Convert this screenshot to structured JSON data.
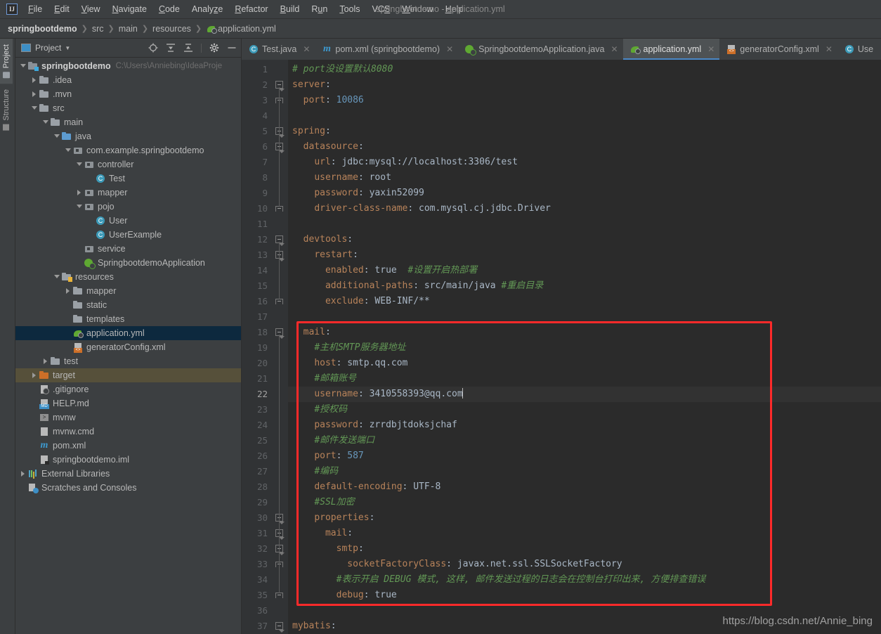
{
  "window": {
    "title": "springbootdemo - application.yml"
  },
  "menu": {
    "items": [
      {
        "label": "File",
        "mnemonic": "F"
      },
      {
        "label": "Edit",
        "mnemonic": "E"
      },
      {
        "label": "View",
        "mnemonic": "V"
      },
      {
        "label": "Navigate",
        "mnemonic": "N"
      },
      {
        "label": "Code",
        "mnemonic": "C"
      },
      {
        "label": "Analyze",
        "mnemonic": "z"
      },
      {
        "label": "Refactor",
        "mnemonic": "R"
      },
      {
        "label": "Build",
        "mnemonic": "B"
      },
      {
        "label": "Run",
        "mnemonic": "u"
      },
      {
        "label": "Tools",
        "mnemonic": "T"
      },
      {
        "label": "VCS",
        "mnemonic": "S"
      },
      {
        "label": "Window",
        "mnemonic": "W"
      },
      {
        "label": "Help",
        "mnemonic": "H"
      }
    ]
  },
  "breadcrumb": {
    "items": [
      "springbootdemo",
      "src",
      "main",
      "resources",
      "application.yml"
    ],
    "file_icon": "spring-yaml-icon"
  },
  "toolwindow_bar": {
    "tabs": [
      {
        "label": "Project",
        "icon": "project-folder-icon",
        "active": true
      },
      {
        "label": "Structure",
        "icon": "structure-icon",
        "active": false
      }
    ]
  },
  "project_panel": {
    "title": "Project",
    "dropdown_icon": "chevron-down-icon",
    "tools": [
      {
        "name": "locate-icon",
        "title": "Select Opened File"
      },
      {
        "name": "expand-all-icon",
        "title": "Expand All"
      },
      {
        "name": "collapse-all-icon",
        "title": "Collapse All"
      },
      {
        "name": "gear-icon",
        "title": "Settings"
      },
      {
        "name": "hide-icon",
        "title": "Hide"
      }
    ],
    "tree": [
      {
        "indent": 0,
        "arrow": "open",
        "icon": "module-folder-icon",
        "label": "springbootdemo",
        "bold": true,
        "path": "C:\\Users\\Anniebing\\IdeaProje",
        "state": "normal"
      },
      {
        "indent": 1,
        "arrow": "closed",
        "icon": "folder-icon",
        "label": ".idea",
        "state": "normal"
      },
      {
        "indent": 1,
        "arrow": "closed",
        "icon": "folder-icon",
        "label": ".mvn",
        "state": "normal"
      },
      {
        "indent": 1,
        "arrow": "open",
        "icon": "folder-icon",
        "label": "src",
        "state": "normal"
      },
      {
        "indent": 2,
        "arrow": "open",
        "icon": "folder-icon",
        "label": "main",
        "state": "normal"
      },
      {
        "indent": 3,
        "arrow": "open",
        "icon": "source-folder-icon",
        "label": "java",
        "state": "normal"
      },
      {
        "indent": 4,
        "arrow": "open",
        "icon": "package-icon",
        "label": "com.example.springbootdemo",
        "state": "normal"
      },
      {
        "indent": 5,
        "arrow": "open",
        "icon": "package-icon",
        "label": "controller",
        "state": "normal"
      },
      {
        "indent": 6,
        "arrow": "none",
        "icon": "java-class-icon",
        "label": "Test",
        "state": "normal"
      },
      {
        "indent": 5,
        "arrow": "closed",
        "icon": "package-icon",
        "label": "mapper",
        "state": "normal"
      },
      {
        "indent": 5,
        "arrow": "open",
        "icon": "package-icon",
        "label": "pojo",
        "state": "normal"
      },
      {
        "indent": 6,
        "arrow": "none",
        "icon": "java-class-icon",
        "label": "User",
        "state": "normal"
      },
      {
        "indent": 6,
        "arrow": "none",
        "icon": "java-class-icon",
        "label": "UserExample",
        "state": "normal"
      },
      {
        "indent": 5,
        "arrow": "none",
        "icon": "package-icon",
        "label": "service",
        "state": "normal"
      },
      {
        "indent": 5,
        "arrow": "none",
        "icon": "spring-app-icon",
        "label": "SpringbootdemoApplication",
        "state": "normal"
      },
      {
        "indent": 3,
        "arrow": "open",
        "icon": "resources-folder-icon",
        "label": "resources",
        "state": "normal"
      },
      {
        "indent": 4,
        "arrow": "closed",
        "icon": "folder-icon",
        "label": "mapper",
        "state": "normal"
      },
      {
        "indent": 4,
        "arrow": "none",
        "icon": "folder-icon",
        "label": "static",
        "state": "normal"
      },
      {
        "indent": 4,
        "arrow": "none",
        "icon": "folder-icon",
        "label": "templates",
        "state": "normal"
      },
      {
        "indent": 4,
        "arrow": "none",
        "icon": "spring-yaml-icon",
        "label": "application.yml",
        "state": "selected"
      },
      {
        "indent": 4,
        "arrow": "none",
        "icon": "xml-icon",
        "label": "generatorConfig.xml",
        "state": "normal"
      },
      {
        "indent": 2,
        "arrow": "closed",
        "icon": "folder-icon",
        "label": "test",
        "state": "normal"
      },
      {
        "indent": 1,
        "arrow": "closed",
        "icon": "target-folder-icon",
        "label": "target",
        "state": "highlighted"
      },
      {
        "indent": 1,
        "arrow": "none",
        "icon": "gitignore-icon",
        "label": ".gitignore",
        "state": "normal"
      },
      {
        "indent": 1,
        "arrow": "none",
        "icon": "markdown-icon",
        "label": "HELP.md",
        "state": "normal"
      },
      {
        "indent": 1,
        "arrow": "none",
        "icon": "shell-script-icon",
        "label": "mvnw",
        "state": "normal"
      },
      {
        "indent": 1,
        "arrow": "none",
        "icon": "file-icon",
        "label": "mvnw.cmd",
        "state": "normal"
      },
      {
        "indent": 1,
        "arrow": "none",
        "icon": "maven-icon",
        "label": "pom.xml",
        "state": "normal"
      },
      {
        "indent": 1,
        "arrow": "none",
        "icon": "iml-icon",
        "label": "springbootdemo.iml",
        "state": "normal"
      },
      {
        "indent": 0,
        "arrow": "closed",
        "icon": "libraries-icon",
        "label": "External Libraries",
        "state": "normal"
      },
      {
        "indent": 0,
        "arrow": "none",
        "icon": "scratches-icon",
        "label": "Scratches and Consoles",
        "state": "normal"
      }
    ]
  },
  "editor_tabs": [
    {
      "label": "Test.java",
      "icon": "java-class-icon",
      "active": false,
      "closable": true
    },
    {
      "label": "pom.xml (springbootdemo)",
      "icon": "maven-icon",
      "active": false,
      "closable": true
    },
    {
      "label": "SpringbootdemoApplication.java",
      "icon": "spring-app-icon",
      "active": false,
      "closable": true
    },
    {
      "label": "application.yml",
      "icon": "spring-yaml-icon",
      "active": true,
      "closable": true
    },
    {
      "label": "generatorConfig.xml",
      "icon": "xml-icon",
      "active": false,
      "closable": true
    },
    {
      "label": "Use",
      "icon": "java-class-icon",
      "active": false,
      "closable": false
    }
  ],
  "editor": {
    "language": "yaml",
    "current_line": 22,
    "first_line": 1,
    "last_line": 37,
    "lines": [
      {
        "n": 1,
        "indent": 0,
        "fold": "none",
        "tokens": [
          {
            "t": "comment",
            "s": "# port没设置默认8080"
          }
        ]
      },
      {
        "n": 2,
        "indent": 0,
        "fold": "open",
        "tokens": [
          {
            "t": "key",
            "s": "server"
          },
          {
            "t": "punct",
            "s": ":"
          }
        ]
      },
      {
        "n": 3,
        "indent": 1,
        "fold": "end",
        "tokens": [
          {
            "t": "key",
            "s": "port"
          },
          {
            "t": "punct",
            "s": ": "
          },
          {
            "t": "number",
            "s": "10086"
          }
        ]
      },
      {
        "n": 4,
        "indent": 0,
        "fold": "none",
        "tokens": []
      },
      {
        "n": 5,
        "indent": 0,
        "fold": "open",
        "tokens": [
          {
            "t": "key",
            "s": "spring"
          },
          {
            "t": "punct",
            "s": ":"
          }
        ]
      },
      {
        "n": 6,
        "indent": 1,
        "fold": "open",
        "tokens": [
          {
            "t": "key",
            "s": "datasource"
          },
          {
            "t": "punct",
            "s": ":"
          }
        ]
      },
      {
        "n": 7,
        "indent": 2,
        "fold": "line",
        "tokens": [
          {
            "t": "key",
            "s": "url"
          },
          {
            "t": "punct",
            "s": ": "
          },
          {
            "t": "value",
            "s": "jdbc:mysql://localhost:3306/test"
          }
        ]
      },
      {
        "n": 8,
        "indent": 2,
        "fold": "line",
        "tokens": [
          {
            "t": "key",
            "s": "username"
          },
          {
            "t": "punct",
            "s": ": "
          },
          {
            "t": "value",
            "s": "root"
          }
        ]
      },
      {
        "n": 9,
        "indent": 2,
        "fold": "line",
        "tokens": [
          {
            "t": "key",
            "s": "password"
          },
          {
            "t": "punct",
            "s": ": "
          },
          {
            "t": "value",
            "s": "yaxin52099"
          }
        ]
      },
      {
        "n": 10,
        "indent": 2,
        "fold": "end",
        "tokens": [
          {
            "t": "key",
            "s": "driver-class-name"
          },
          {
            "t": "punct",
            "s": ": "
          },
          {
            "t": "value",
            "s": "com.mysql.cj.jdbc.Driver"
          }
        ]
      },
      {
        "n": 11,
        "indent": 0,
        "fold": "line",
        "tokens": []
      },
      {
        "n": 12,
        "indent": 1,
        "fold": "open",
        "tokens": [
          {
            "t": "key",
            "s": "devtools"
          },
          {
            "t": "punct",
            "s": ":"
          }
        ]
      },
      {
        "n": 13,
        "indent": 2,
        "fold": "open",
        "tokens": [
          {
            "t": "key",
            "s": "restart"
          },
          {
            "t": "punct",
            "s": ":"
          }
        ]
      },
      {
        "n": 14,
        "indent": 3,
        "fold": "line",
        "tokens": [
          {
            "t": "key",
            "s": "enabled"
          },
          {
            "t": "punct",
            "s": ": "
          },
          {
            "t": "value",
            "s": "true"
          },
          {
            "t": "comment",
            "s": "  #设置开启热部署"
          }
        ]
      },
      {
        "n": 15,
        "indent": 3,
        "fold": "line",
        "tokens": [
          {
            "t": "key",
            "s": "additional-paths"
          },
          {
            "t": "punct",
            "s": ": "
          },
          {
            "t": "value",
            "s": "src/main/java"
          },
          {
            "t": "comment",
            "s": " #重启目录"
          }
        ]
      },
      {
        "n": 16,
        "indent": 3,
        "fold": "end",
        "tokens": [
          {
            "t": "key",
            "s": "exclude"
          },
          {
            "t": "punct",
            "s": ": "
          },
          {
            "t": "value",
            "s": "WEB-INF/**"
          }
        ]
      },
      {
        "n": 17,
        "indent": 0,
        "fold": "line",
        "tokens": []
      },
      {
        "n": 18,
        "indent": 1,
        "fold": "open",
        "tokens": [
          {
            "t": "key",
            "s": "mail"
          },
          {
            "t": "punct",
            "s": ":"
          }
        ]
      },
      {
        "n": 19,
        "indent": 2,
        "fold": "line",
        "tokens": [
          {
            "t": "comment",
            "s": "#主机SMTP服务器地址"
          }
        ]
      },
      {
        "n": 20,
        "indent": 2,
        "fold": "line",
        "tokens": [
          {
            "t": "key",
            "s": "host"
          },
          {
            "t": "punct",
            "s": ": "
          },
          {
            "t": "value",
            "s": "smtp.qq.com"
          }
        ]
      },
      {
        "n": 21,
        "indent": 2,
        "fold": "line",
        "tokens": [
          {
            "t": "comment",
            "s": "#邮箱账号"
          }
        ]
      },
      {
        "n": 22,
        "indent": 2,
        "fold": "line",
        "tokens": [
          {
            "t": "key",
            "s": "username"
          },
          {
            "t": "punct",
            "s": ": "
          },
          {
            "t": "value",
            "s": "3410558393@qq.com"
          },
          {
            "t": "caret",
            "s": ""
          }
        ]
      },
      {
        "n": 23,
        "indent": 2,
        "fold": "line",
        "tokens": [
          {
            "t": "comment",
            "s": "#授权码"
          }
        ]
      },
      {
        "n": 24,
        "indent": 2,
        "fold": "line",
        "tokens": [
          {
            "t": "key",
            "s": "password"
          },
          {
            "t": "punct",
            "s": ": "
          },
          {
            "t": "value",
            "s": "zrrdbjtdoksjchaf"
          }
        ]
      },
      {
        "n": 25,
        "indent": 2,
        "fold": "line",
        "tokens": [
          {
            "t": "comment",
            "s": "#邮件发送端口"
          }
        ]
      },
      {
        "n": 26,
        "indent": 2,
        "fold": "line",
        "tokens": [
          {
            "t": "key",
            "s": "port"
          },
          {
            "t": "punct",
            "s": ": "
          },
          {
            "t": "number",
            "s": "587"
          }
        ]
      },
      {
        "n": 27,
        "indent": 2,
        "fold": "line",
        "tokens": [
          {
            "t": "comment",
            "s": "#编码"
          }
        ]
      },
      {
        "n": 28,
        "indent": 2,
        "fold": "line",
        "tokens": [
          {
            "t": "key",
            "s": "default-encoding"
          },
          {
            "t": "punct",
            "s": ": "
          },
          {
            "t": "value",
            "s": "UTF-8"
          }
        ]
      },
      {
        "n": 29,
        "indent": 2,
        "fold": "line",
        "tokens": [
          {
            "t": "comment",
            "s": "#SSL加密"
          }
        ]
      },
      {
        "n": 30,
        "indent": 2,
        "fold": "open",
        "tokens": [
          {
            "t": "key",
            "s": "properties"
          },
          {
            "t": "punct",
            "s": ":"
          }
        ]
      },
      {
        "n": 31,
        "indent": 3,
        "fold": "open",
        "tokens": [
          {
            "t": "key",
            "s": "mail"
          },
          {
            "t": "punct",
            "s": ":"
          }
        ]
      },
      {
        "n": 32,
        "indent": 4,
        "fold": "open",
        "tokens": [
          {
            "t": "key",
            "s": "smtp"
          },
          {
            "t": "punct",
            "s": ":"
          }
        ]
      },
      {
        "n": 33,
        "indent": 5,
        "fold": "end",
        "tokens": [
          {
            "t": "key",
            "s": "socketFactoryClass"
          },
          {
            "t": "punct",
            "s": ": "
          },
          {
            "t": "value",
            "s": "javax.net.ssl.SSLSocketFactory"
          }
        ]
      },
      {
        "n": 34,
        "indent": 4,
        "fold": "line",
        "tokens": [
          {
            "t": "comment",
            "s": "#表示开启 DEBUG 模式, 这样, 邮件发送过程的日志会在控制台打印出来, 方便排查错误"
          }
        ]
      },
      {
        "n": 35,
        "indent": 4,
        "fold": "end",
        "tokens": [
          {
            "t": "key",
            "s": "debug"
          },
          {
            "t": "punct",
            "s": ": "
          },
          {
            "t": "value",
            "s": "true"
          }
        ]
      },
      {
        "n": 36,
        "indent": 0,
        "fold": "line",
        "tokens": []
      },
      {
        "n": 37,
        "indent": 0,
        "fold": "open",
        "tokens": [
          {
            "t": "key",
            "s": "mybatis"
          },
          {
            "t": "punct",
            "s": ":"
          }
        ]
      }
    ]
  },
  "annotation": {
    "highlight_box": {
      "color": "#fd2a2a",
      "from_line": 18,
      "to_line": 35,
      "label": "mail-config-highlight"
    }
  },
  "watermark": {
    "text": "https://blog.csdn.net/Annie_bing"
  },
  "colors": {
    "key": "#b8835a",
    "value": "#a9b7c6",
    "number": "#6897bb",
    "comment": "#629755",
    "editor_bg": "#2b2b2b",
    "panel_bg": "#3c3f41",
    "selection": "#0d293e",
    "target_highlight": "#56503a",
    "tab_accent": "#4a88c7",
    "annotation": "#fd2a2a"
  }
}
